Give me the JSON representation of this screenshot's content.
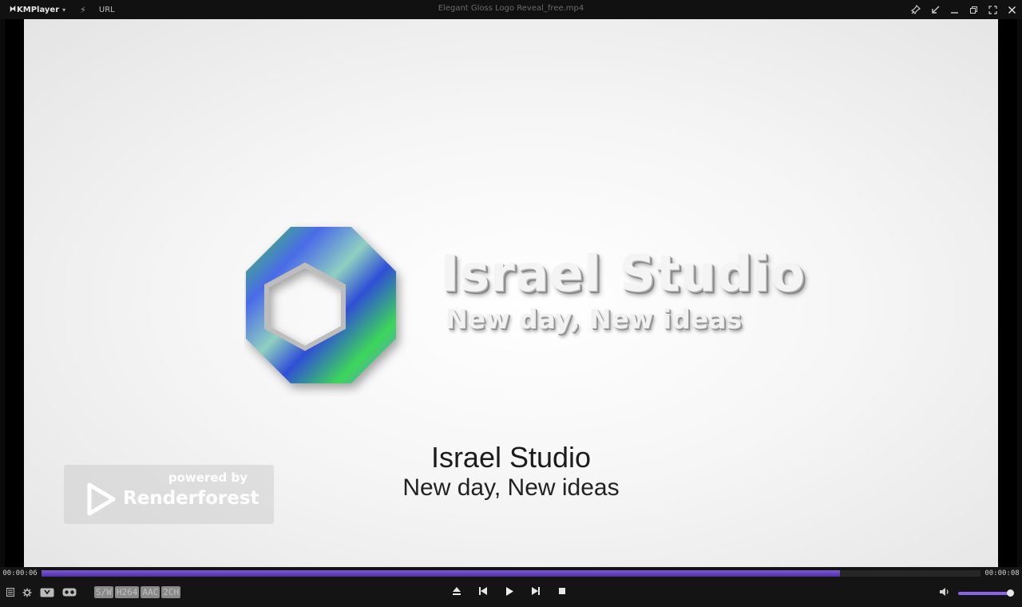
{
  "app": {
    "name": "KMPlayer",
    "url_label": "URL",
    "window_title": "Elegant Gloss Logo Reveal_free.mp4"
  },
  "video": {
    "logo_title": "Israel Studio",
    "logo_subtitle": "New day, New ideas",
    "caption_title": "Israel Studio",
    "caption_subtitle": "New day, New ideas",
    "watermark_powered": "powered by",
    "watermark_name": "Renderforest"
  },
  "playback": {
    "elapsed": "00:00:06",
    "total": "00:00:08",
    "progress": 0.85,
    "volume": 0.95
  },
  "badges": [
    "S/W",
    "H264",
    "AAC",
    "2CH"
  ],
  "colors": {
    "accent": "#6a48c4",
    "volume": "#8a63e6"
  },
  "icons": {
    "titlebar": [
      "pin-icon",
      "compact-icon",
      "minimize-icon",
      "restore-icon",
      "fullscreen-icon",
      "close-icon"
    ],
    "controls": [
      "open-eject-icon",
      "previous-icon",
      "play-icon",
      "next-icon",
      "stop-icon"
    ]
  }
}
